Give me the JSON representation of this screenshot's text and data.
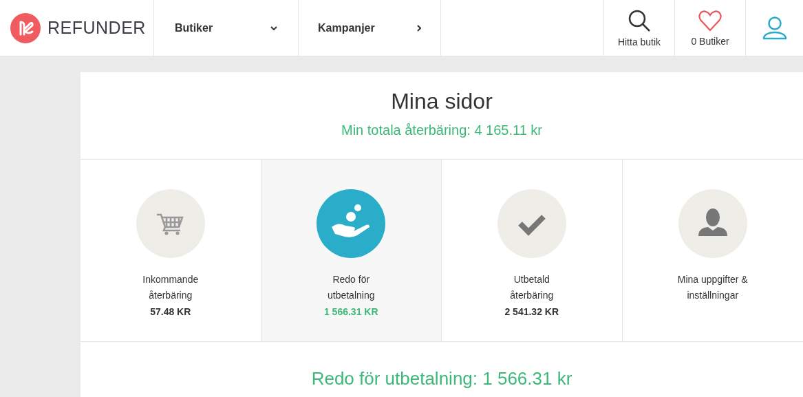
{
  "header": {
    "logo": "REFUNDER",
    "nav": [
      {
        "label": "Butiker",
        "kind": "dropdown"
      },
      {
        "label": "Kampanjer",
        "kind": "link"
      }
    ],
    "actions": [
      {
        "label": "Hitta butik",
        "kind": "search"
      },
      {
        "label": "0 Butiker",
        "kind": "favorites"
      },
      {
        "kind": "account"
      }
    ]
  },
  "page": {
    "title": "Mina sidor",
    "total": "Min totala återbäring: 4 165.11 kr"
  },
  "tiles": [
    {
      "label": "Inkommande återbäring",
      "amount": "57.48 KR",
      "kind": "cart",
      "selected": false
    },
    {
      "label": "Redo för utbetalning",
      "amount": "1 566.31 KR",
      "kind": "payout",
      "selected": true
    },
    {
      "label": "Utbetald återbäring",
      "amount": "2 541.32 KR",
      "kind": "check",
      "selected": false
    },
    {
      "label": "Mina uppgifter & inställningar",
      "kind": "profile",
      "selected": false
    }
  ],
  "section": {
    "heading": "Redo för utbetalning: 1 566.31 kr"
  }
}
